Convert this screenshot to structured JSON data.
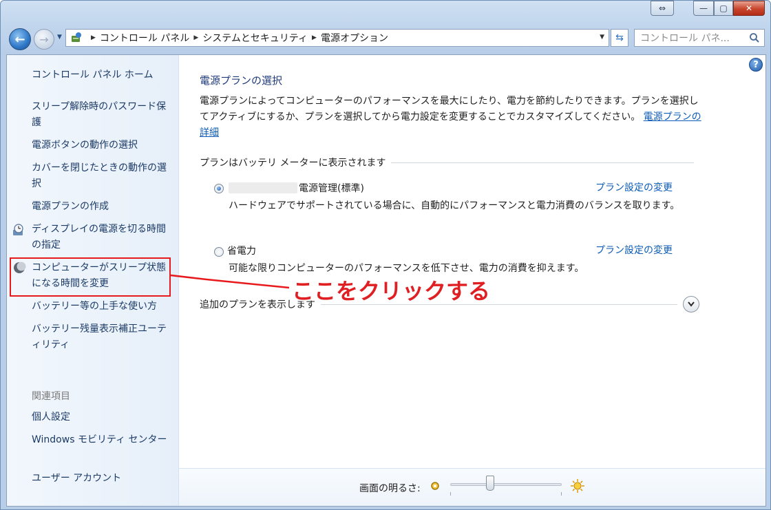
{
  "window": {
    "caption": {
      "restore_small": "⇔",
      "minimize": "—",
      "maximize": "▢",
      "close": "✕"
    }
  },
  "navbar": {
    "breadcrumbs": [
      "コントロール パネル",
      "システムとセキュリティ",
      "電源オプション"
    ],
    "search_placeholder": "コントロール パネ..."
  },
  "sidebar": {
    "items": [
      {
        "label": "コントロール パネル ホーム"
      },
      {
        "label": "スリープ解除時のパスワード保護"
      },
      {
        "label": "電源ボタンの動作の選択"
      },
      {
        "label": "カバーを閉じたときの動作の選択"
      },
      {
        "label": "電源プランの作成"
      },
      {
        "label": "ディスプレイの電源を切る時間の指定",
        "icon": "clock-icon"
      },
      {
        "label": "コンピューターがスリープ状態になる時間を変更",
        "icon": "moon-icon"
      },
      {
        "label": "バッテリー等の上手な使い方"
      },
      {
        "label": "バッテリー残量表示補正ユーティリティ"
      }
    ],
    "related_heading": "関連項目",
    "related": [
      {
        "label": "個人設定"
      },
      {
        "label": "Windows モビリティ センター"
      },
      {
        "label": "ユーザー アカウント"
      }
    ]
  },
  "main": {
    "title": "電源プランの選択",
    "description": "電源プランによってコンピューターのパフォーマンスを最大にしたり、電力を節約したりできます。プランを選択してアクティブにするか、プランを選択してから電力設定を変更することでカスタマイズしてください。",
    "details_link": "電源プランの詳細",
    "group_header": "プランはバッテリ メーターに表示されます",
    "plans": [
      {
        "name": "電源管理(標準)",
        "selected": true,
        "change_link": "プラン設定の変更",
        "description": "ハードウェアでサポートされている場合に、自動的にパフォーマンスと電力消費のバランスを取ります。"
      },
      {
        "name": "省電力",
        "selected": false,
        "change_link": "プラン設定の変更",
        "description": "可能な限りコンピューターのパフォーマンスを低下させ、電力の消費を抑えます。"
      }
    ],
    "more_plans": "追加のプランを表示します"
  },
  "bottom": {
    "brightness_label": "画面の明るさ:",
    "brightness_level": 0.36
  },
  "annotation": {
    "callout": "ここをクリックする",
    "color": "#e8191c"
  }
}
